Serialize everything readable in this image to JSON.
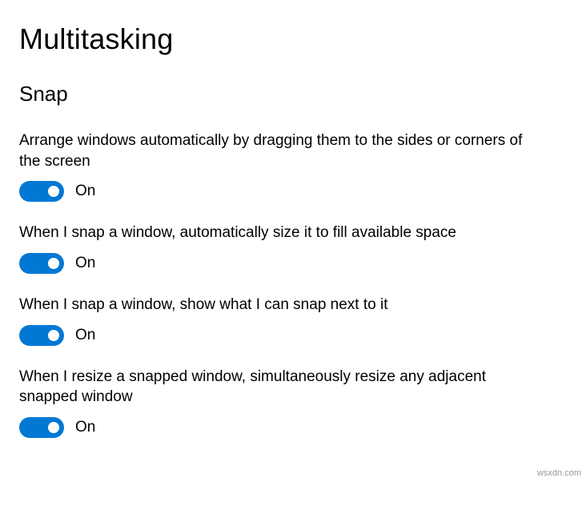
{
  "page": {
    "title": "Multitasking"
  },
  "section": {
    "title": "Snap"
  },
  "settings": [
    {
      "label": "Arrange windows automatically by dragging them to the sides or corners of the screen",
      "state": "On",
      "on": true
    },
    {
      "label": "When I snap a window, automatically size it to fill available space",
      "state": "On",
      "on": true
    },
    {
      "label": "When I snap a window, show what I can snap next to it",
      "state": "On",
      "on": true
    },
    {
      "label": "When I resize a snapped window, simultaneously resize any adjacent snapped window",
      "state": "On",
      "on": true
    }
  ],
  "watermark": "wsxdn.com"
}
